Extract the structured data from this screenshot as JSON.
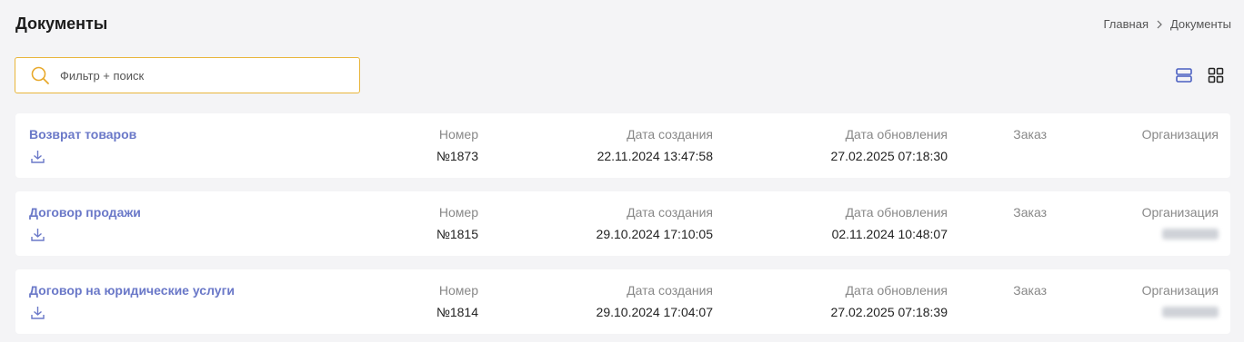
{
  "header": {
    "title": "Документы",
    "breadcrumb": {
      "home": "Главная",
      "current": "Документы"
    }
  },
  "search": {
    "placeholder": "Фильтр + поиск",
    "value": ""
  },
  "columns": {
    "number": "Номер",
    "created": "Дата создания",
    "updated": "Дата обновления",
    "order": "Заказ",
    "organization": "Организация"
  },
  "documents": [
    {
      "title": "Возврат товаров",
      "number": "№1873",
      "created": "22.11.2024 13:47:58",
      "updated": "27.02.2025 07:18:30",
      "order": "",
      "organization": ""
    },
    {
      "title": "Договор продажи",
      "number": "№1815",
      "created": "29.10.2024 17:10:05",
      "updated": "02.11.2024 10:48:07",
      "order": "",
      "organization": ""
    },
    {
      "title": "Договор на юридические услуги",
      "number": "№1814",
      "created": "29.10.2024 17:04:07",
      "updated": "27.02.2025 07:18:39",
      "order": "",
      "organization": ""
    }
  ],
  "icons": {
    "search": "search-icon",
    "breadcrumb_separator": "chevron-right-icon",
    "list_view": "list-view-icon",
    "grid_view": "grid-view-icon",
    "download": "download-icon"
  },
  "colors": {
    "accent": "#6a78c8",
    "search_border": "#e8b53a",
    "active_view": "#4a5fc1"
  }
}
